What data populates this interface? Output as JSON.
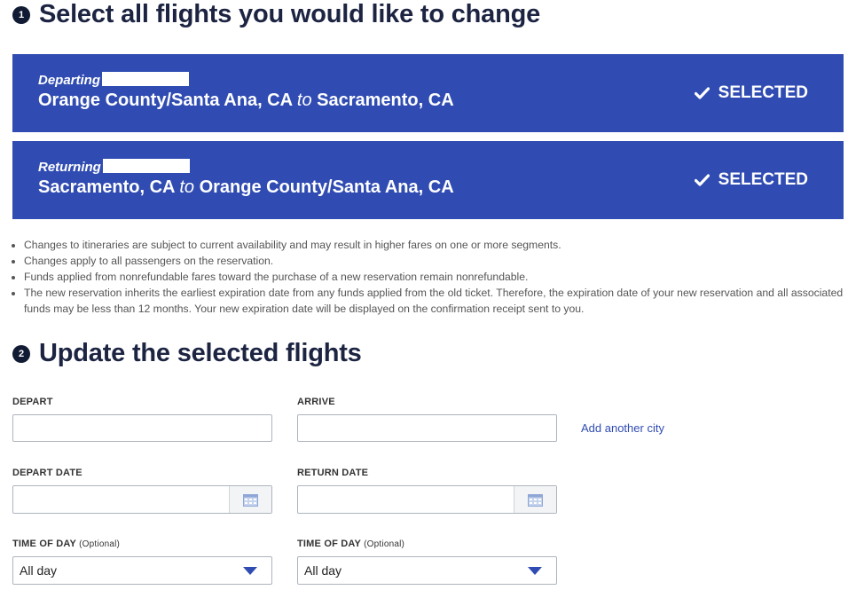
{
  "step1": {
    "number": "1",
    "title": "Select all flights you would like to change"
  },
  "flights": [
    {
      "label": "Departing",
      "origin": "Orange County/Santa Ana, CA",
      "connector": "to",
      "destination": "Sacramento, CA",
      "status": "SELECTED"
    },
    {
      "label": "Returning",
      "origin": "Sacramento, CA",
      "connector": "to",
      "destination": "Orange County/Santa Ana, CA",
      "status": "SELECTED"
    }
  ],
  "notes": [
    "Changes to itineraries are subject to current availability and may result in higher fares on one or more segments.",
    "Changes apply to all passengers on the reservation.",
    "Funds applied from nonrefundable fares toward the purchase of a new reservation remain nonrefundable.",
    "The new reservation inherits the earliest expiration date from any funds applied from the old ticket. Therefore, the expiration date of your new reservation and all associated funds may be less than 12 months. Your new expiration date will be displayed on the confirmation receipt sent to you."
  ],
  "step2": {
    "number": "2",
    "title": "Update the selected flights"
  },
  "form": {
    "depart_label": "DEPART",
    "arrive_label": "ARRIVE",
    "depart_value": "",
    "arrive_value": "",
    "add_city": "Add another city",
    "depart_date_label": "DEPART DATE",
    "return_date_label": "RETURN DATE",
    "depart_date_value": "",
    "return_date_value": "",
    "tod_label": "TIME OF DAY",
    "tod_optional": "(Optional)",
    "tod_depart_value": "All day",
    "tod_return_value": "All day"
  },
  "colors": {
    "brand_blue": "#304cb2",
    "heading": "#1c2442"
  },
  "icons": {
    "check": "checkmark-icon",
    "calendar": "calendar-icon",
    "caret": "caret-down-icon"
  }
}
